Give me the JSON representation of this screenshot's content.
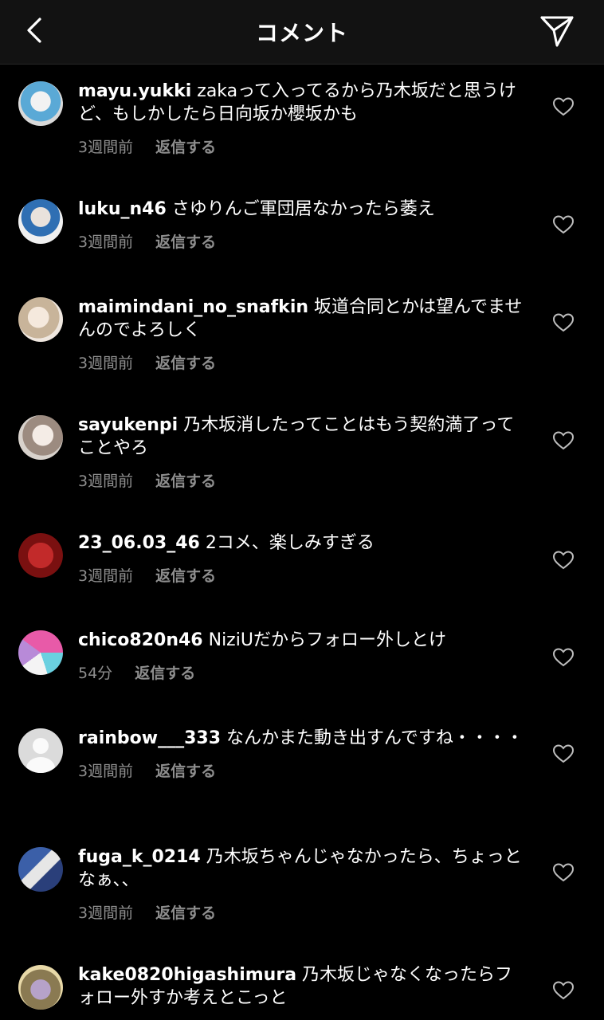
{
  "header": {
    "title": "コメント",
    "back_icon": "chevron-left-icon",
    "send_icon": "paper-plane-icon"
  },
  "comments": [
    {
      "username": "mayu.yukki",
      "text": "zakaって入ってるから乃木坂だと思うけど、もしかしたら日向坂か櫻坂かも",
      "time": "3週間前",
      "reply": "返信する"
    },
    {
      "username": "luku_n46",
      "text": "さゆりんご軍団居なかったら萎え",
      "time": "3週間前",
      "reply": "返信する"
    },
    {
      "username": "maimindani_no_snafkin",
      "text": "坂道合同とかは望んでませんのでよろしく",
      "time": "3週間前",
      "reply": "返信する"
    },
    {
      "username": "sayukenpi",
      "text": "乃木坂消したってことはもう契約満了ってことやろ",
      "time": "3週間前",
      "reply": "返信する"
    },
    {
      "username": "23_06.03_46",
      "text": "2コメ、楽しみすぎる",
      "time": "3週間前",
      "reply": "返信する"
    },
    {
      "username": "chico820n46",
      "text": "NiziUだからフォロー外しとけ",
      "time": "54分",
      "reply": "返信する"
    },
    {
      "username": "rainbow___333",
      "text": "なんかまた動き出すんですね・・・・",
      "time": "3週間前",
      "reply": "返信する"
    },
    {
      "username": "fuga_k_0214",
      "text": "乃木坂ちゃんじゃなかったら、ちょっとなぁ、、",
      "time": "3週間前",
      "reply": "返信する"
    },
    {
      "username": "kake0820higashimura",
      "text": "乃木坂じゃなくなったらフォロー外すか考えとこっと",
      "time": "",
      "reply": ""
    }
  ],
  "colors": {
    "background": "#000000",
    "header": "#121212",
    "meta": "#8e8e8e"
  }
}
